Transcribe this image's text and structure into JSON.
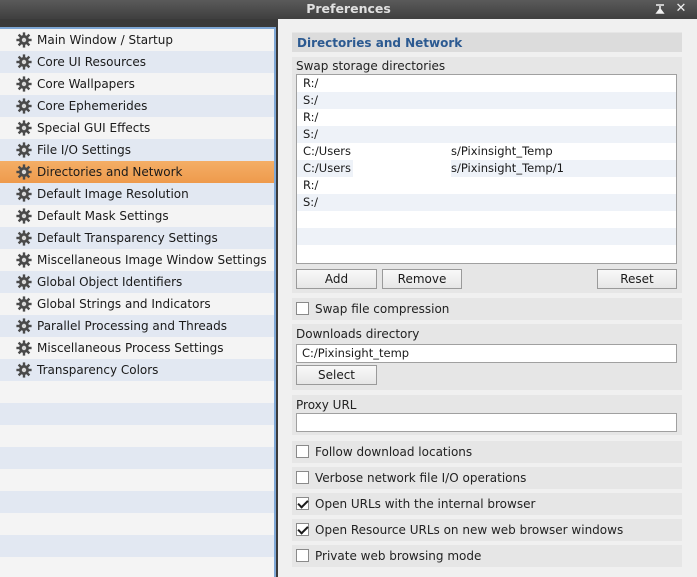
{
  "window": {
    "title": "Preferences"
  },
  "sidebar": {
    "items": [
      {
        "label": "Main Window / Startup"
      },
      {
        "label": "Core UI Resources"
      },
      {
        "label": "Core Wallpapers"
      },
      {
        "label": "Core Ephemerides"
      },
      {
        "label": "Special GUI Effects"
      },
      {
        "label": "File I/O Settings"
      },
      {
        "label": "Directories and Network",
        "selected": true
      },
      {
        "label": "Default Image Resolution"
      },
      {
        "label": "Default Mask Settings"
      },
      {
        "label": "Default Transparency Settings"
      },
      {
        "label": "Miscellaneous Image Window Settings"
      },
      {
        "label": "Global Object Identifiers"
      },
      {
        "label": "Global Strings and Indicators"
      },
      {
        "label": "Parallel Processing and Threads"
      },
      {
        "label": "Miscellaneous Process Settings"
      },
      {
        "label": "Transparency Colors"
      }
    ]
  },
  "section": {
    "title": "Directories and Network"
  },
  "swap": {
    "label": "Swap storage directories",
    "directories": [
      {
        "prefix": "R:/",
        "suffix": ""
      },
      {
        "prefix": "S:/",
        "suffix": ""
      },
      {
        "prefix": "R:/",
        "suffix": ""
      },
      {
        "prefix": "S:/",
        "suffix": ""
      },
      {
        "prefix": "C:/Users",
        "suffix": "s/Pixinsight_Temp",
        "redacted": true
      },
      {
        "prefix": "C:/Users",
        "suffix": "s/Pixinsight_Temp/1",
        "redacted": true
      },
      {
        "prefix": "R:/",
        "suffix": ""
      },
      {
        "prefix": "S:/",
        "suffix": ""
      }
    ],
    "add_label": "Add",
    "remove_label": "Remove",
    "reset_label": "Reset",
    "compression_label": "Swap file compression",
    "compression_checked": false
  },
  "downloads": {
    "label": "Downloads directory",
    "value": "C:/Pixinsight_temp",
    "select_label": "Select"
  },
  "proxy": {
    "label": "Proxy URL",
    "value": ""
  },
  "options": [
    {
      "label": "Follow download locations",
      "checked": false
    },
    {
      "label": "Verbose network file I/O operations",
      "checked": false
    },
    {
      "label": "Open URLs with the internal browser",
      "checked": true
    },
    {
      "label": "Open Resource URLs on new web browser windows",
      "checked": true
    },
    {
      "label": "Private web browsing mode",
      "checked": false
    }
  ],
  "icons": {
    "pin": "pin-icon",
    "close": "close-icon",
    "gear": "gear-icon"
  },
  "colors": {
    "accent": "#2c5a91",
    "selection": "#f0a35a",
    "titlebar": "#4a4a4a"
  }
}
